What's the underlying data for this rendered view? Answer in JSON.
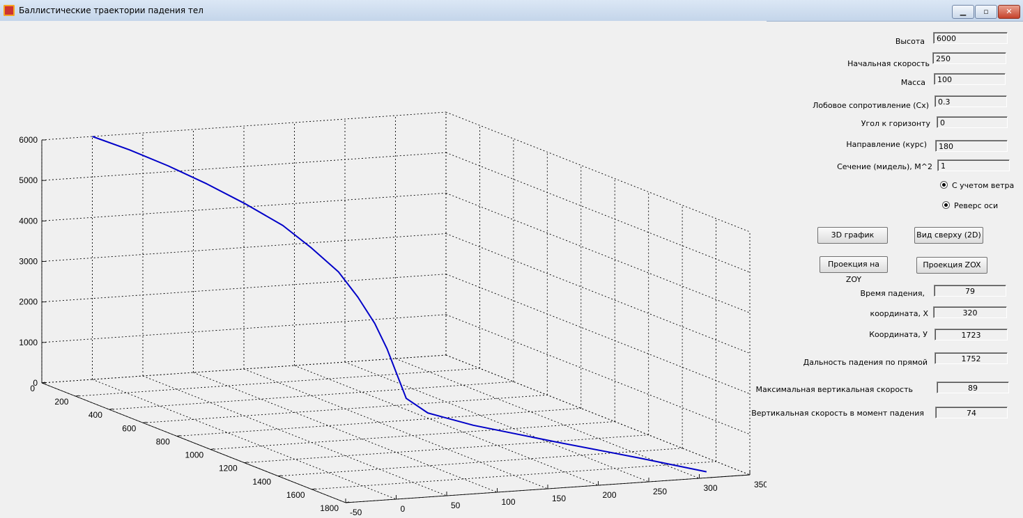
{
  "window": {
    "title": "Баллистические траектории падения тел",
    "minimize_glyph": "▁",
    "maximize_glyph": "▫",
    "close_glyph": "✕"
  },
  "inputs": [
    {
      "label": "Высота",
      "value": "6000"
    },
    {
      "label": "Начальная скорость",
      "value": "250"
    },
    {
      "label": "Масса",
      "value": "100"
    },
    {
      "label": "Лобовое сопротивление (Cx)",
      "value": "0.3"
    },
    {
      "label": "Угол к горизонту",
      "value": "0"
    },
    {
      "label": "Направление  (курс)",
      "value": "180"
    },
    {
      "label": "Сечение (мидель), М^2",
      "value": "1"
    }
  ],
  "options": [
    {
      "label": "С учетом ветра",
      "checked": true
    },
    {
      "label": "Реверс оси",
      "checked": true
    }
  ],
  "buttons": {
    "plot3d": "3D график",
    "top_view": "Вид сверху (2D)",
    "proj_zoy": "Проекция на ZOY",
    "proj_zox": "Проекция ZOX"
  },
  "results": [
    {
      "label": "Время падения,",
      "value": "79"
    },
    {
      "label": "координата, X",
      "value": "320"
    },
    {
      "label": "Координата, У",
      "value": "1723"
    },
    {
      "label": "Дальность падения по прямой",
      "value": "1752"
    },
    {
      "label": "Максимальная вертикальная скорость",
      "value": "89"
    },
    {
      "label": "Вертикальная  скорость в момент падения",
      "value": "74"
    }
  ],
  "chart_data": {
    "type": "line",
    "z_ticks": [
      "0",
      "1000",
      "2000",
      "3000",
      "4000",
      "5000",
      "6000"
    ],
    "y_ticks": [
      "0",
      "200",
      "400",
      "600",
      "800",
      "1000",
      "1200",
      "1400",
      "1600",
      "1800"
    ],
    "x_ticks": [
      "-50",
      "0",
      "50",
      "100",
      "150",
      "200",
      "250",
      "300",
      "350"
    ],
    "zlim": [
      0,
      6000
    ],
    "ylim": [
      0,
      1800
    ],
    "xlim": [
      -50,
      350
    ],
    "grid": true,
    "line_color": "#0000c8",
    "trajectory": [
      {
        "x": 0,
        "y": 0,
        "z": 6000
      },
      {
        "x": 20,
        "y": 100,
        "z": 5800
      },
      {
        "x": 40,
        "y": 210,
        "z": 5550
      },
      {
        "x": 60,
        "y": 320,
        "z": 5250
      },
      {
        "x": 80,
        "y": 430,
        "z": 4900
      },
      {
        "x": 100,
        "y": 530,
        "z": 4500
      },
      {
        "x": 115,
        "y": 610,
        "z": 4050
      },
      {
        "x": 130,
        "y": 680,
        "z": 3550
      },
      {
        "x": 140,
        "y": 735,
        "z": 3000
      },
      {
        "x": 150,
        "y": 775,
        "z": 2400
      },
      {
        "x": 158,
        "y": 800,
        "z": 1800
      },
      {
        "x": 165,
        "y": 815,
        "z": 1200
      },
      {
        "x": 172,
        "y": 830,
        "z": 600
      },
      {
        "x": 185,
        "y": 880,
        "z": 300
      },
      {
        "x": 210,
        "y": 1000,
        "z": 150
      },
      {
        "x": 250,
        "y": 1250,
        "z": 80
      },
      {
        "x": 290,
        "y": 1500,
        "z": 30
      },
      {
        "x": 320,
        "y": 1723,
        "z": 0
      }
    ]
  }
}
